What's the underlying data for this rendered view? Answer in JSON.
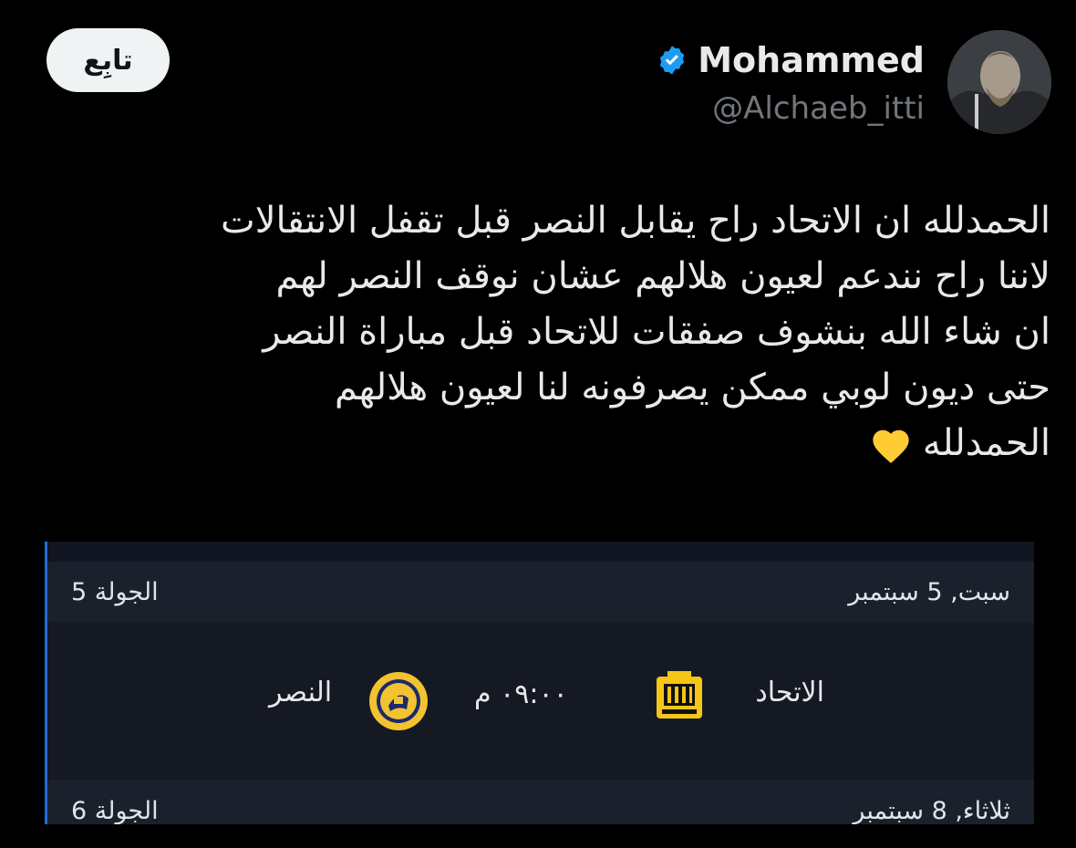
{
  "follow_button": {
    "label": "تابِع"
  },
  "user": {
    "display_name": "Mohammed",
    "handle": "@Alchaeb_itti",
    "verified": true,
    "avatar_icon": "avatar-image"
  },
  "tweet": {
    "lines": [
      "الحمدلله ان الاتحاد راح يقابل النصر قبل تقفل الانتقالات",
      "لاننا راح نندعم لعيون هلالهم عشان نوقف النصر لهم",
      "ان شاء الله بنشوف صفقات للاتحاد قبل مباراة النصر",
      "حتى ديون لوبي ممكن يصرفونه لنا لعيون هلالهم",
      "الحمدلله"
    ],
    "emoji": "yellow-heart-icon"
  },
  "fixtures_card": {
    "rounds": [
      {
        "date": "سبت, 5 سبتمبر",
        "round": "الجولة 5"
      },
      {
        "date": "ثلاثاء, 8 سبتمبر",
        "round": "الجولة 6"
      }
    ],
    "match": {
      "home_team": "الاتحاد",
      "away_team": "النصر",
      "time": "٠٩:٠٠ م"
    }
  },
  "colors": {
    "background": "#000000",
    "verified_blue": "#1d9bf0",
    "card_accent": "#1d6fd6",
    "ittihad_yellow": "#f5c518",
    "nassr_yellow": "#f2c230"
  }
}
